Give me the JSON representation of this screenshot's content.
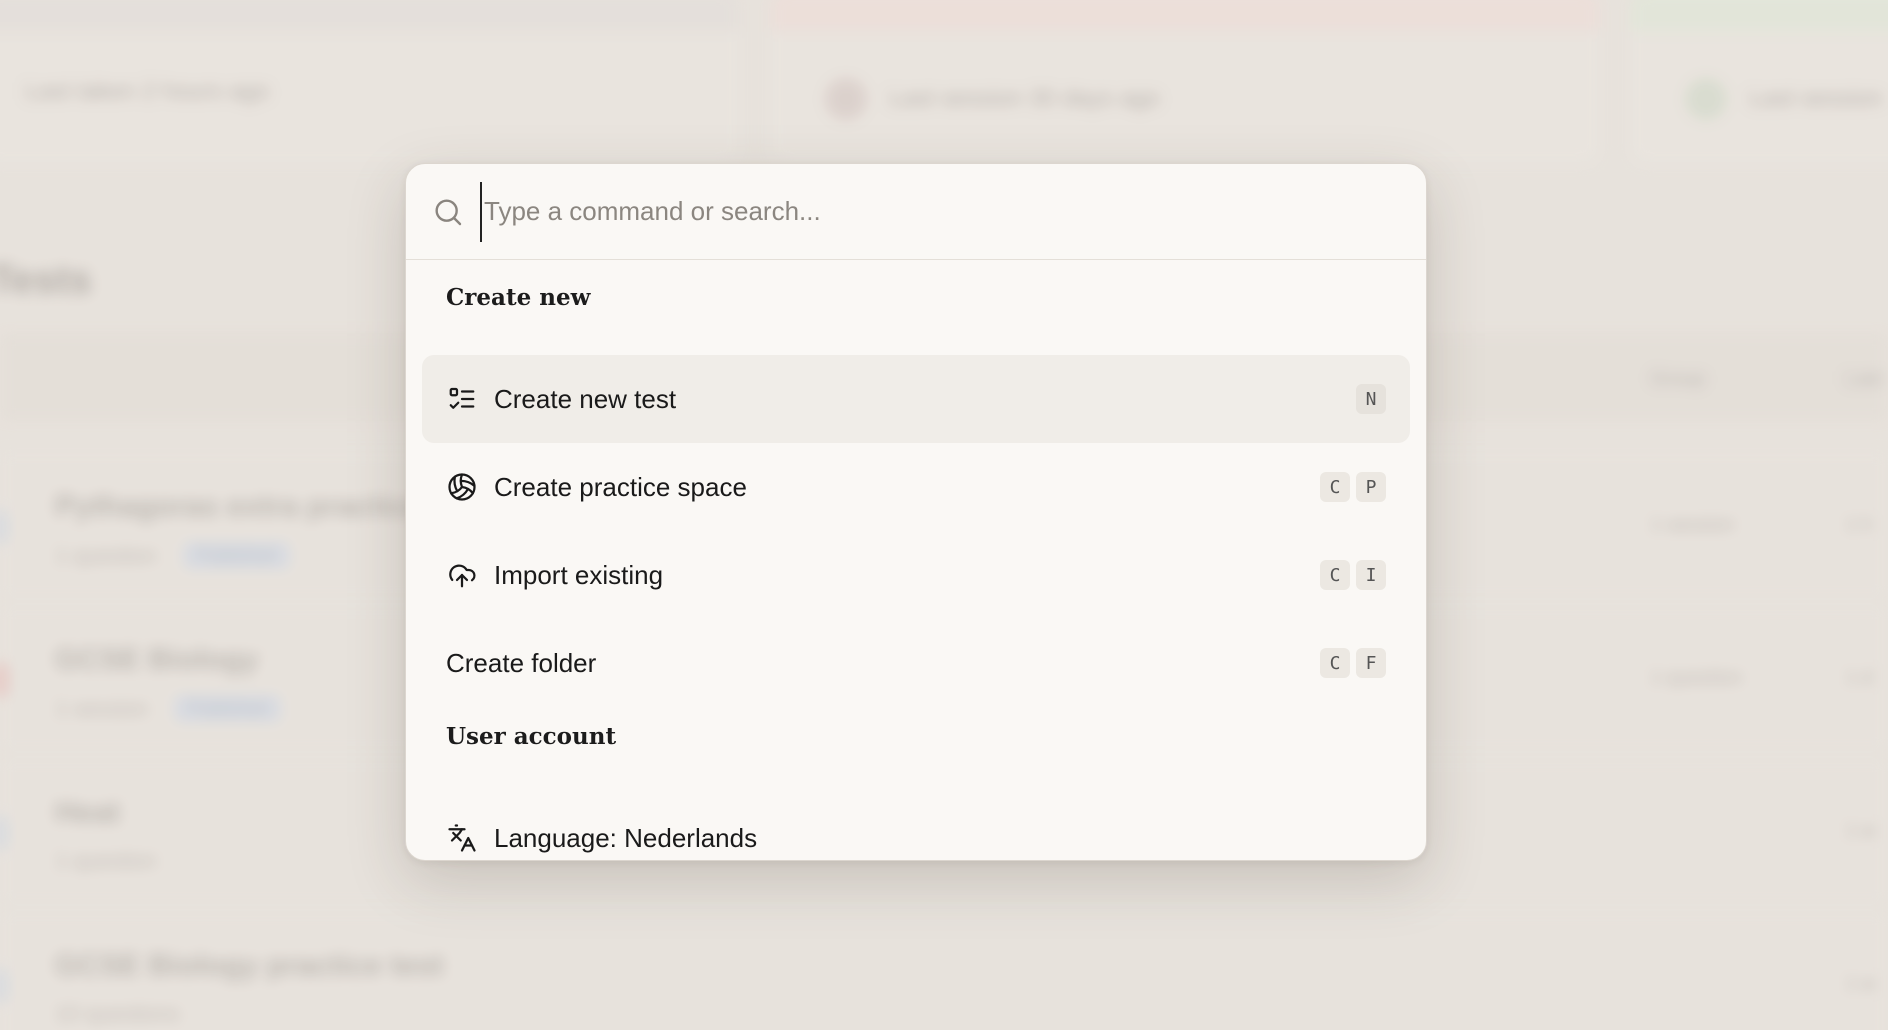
{
  "background": {
    "cards": [
      {
        "meta": "Last taken 2 hours ago",
        "strip_color": "#e4e0da"
      },
      {
        "meta": "Last session 30 days ago",
        "strip_color": "#efdcd8"
      },
      {
        "meta": "Last session",
        "strip_color": "#dfe8d8"
      }
    ],
    "section_heading": "Tests",
    "table_columns": [
      "Group",
      "Last"
    ],
    "rows": [
      {
        "title": "Pythagoras extra practice",
        "sub": "1 question",
        "tag": "Published",
        "right1": "1 session",
        "right2": "1 h"
      },
      {
        "title": "GCSE Biology",
        "sub": "1 session",
        "tag": "Published",
        "right1": "1 question",
        "right2": "1 d"
      },
      {
        "title": "Heat",
        "sub": "1 question",
        "tag": "",
        "right1": "",
        "right2": "1 w"
      },
      {
        "title": "GCSE Biology practice test",
        "sub": "10 questions",
        "tag": "",
        "right1": "",
        "right2": "1 w"
      }
    ]
  },
  "palette": {
    "search": {
      "placeholder": "Type a command or search...",
      "value": ""
    },
    "groups": [
      {
        "label": "Create new",
        "items": [
          {
            "label": "Create new test",
            "icon": "list-checks-icon",
            "keys": [
              "N"
            ],
            "active": true
          },
          {
            "label": "Create practice space",
            "icon": "volleyball-icon",
            "keys": [
              "C",
              "P"
            ]
          },
          {
            "label": "Import existing",
            "icon": "cloud-upload-icon",
            "keys": [
              "C",
              "I"
            ]
          },
          {
            "label": "Create folder",
            "icon": "",
            "keys": [
              "C",
              "F"
            ]
          }
        ]
      },
      {
        "label": "User account",
        "items": [
          {
            "label": "Language: Nederlands",
            "icon": "languages-icon",
            "keys": []
          }
        ]
      }
    ]
  }
}
